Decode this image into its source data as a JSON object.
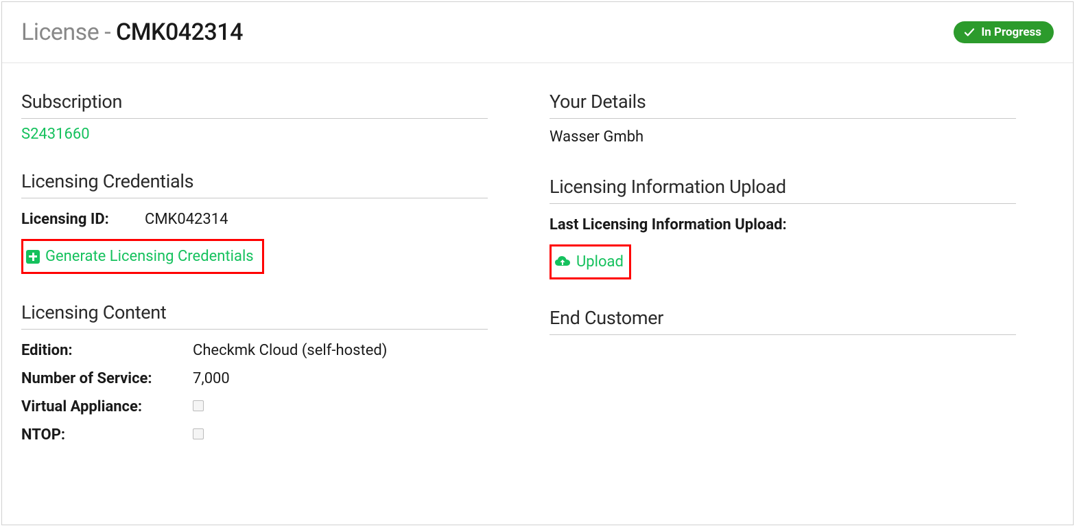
{
  "header": {
    "prefix": "License - ",
    "code": "CMK042314",
    "status": "In Progress"
  },
  "subscription": {
    "title": "Subscription",
    "id": "S2431660"
  },
  "credentials": {
    "title": "Licensing Credentials",
    "id_label": "Licensing ID:",
    "id_value": "CMK042314",
    "generate_label": "Generate Licensing Credentials"
  },
  "content": {
    "title": "Licensing Content",
    "edition_label": "Edition:",
    "edition_value": "Checkmk Cloud (self-hosted)",
    "services_label": "Number of Service:",
    "services_value": "7,000",
    "va_label": "Virtual Appliance:",
    "ntop_label": "NTOP:"
  },
  "details": {
    "title": "Your Details",
    "company": "Wasser Gmbh"
  },
  "upload": {
    "title": "Licensing Information Upload",
    "last_label": "Last Licensing Information Upload:",
    "upload_label": "Upload"
  },
  "end_customer": {
    "title": "End Customer"
  }
}
